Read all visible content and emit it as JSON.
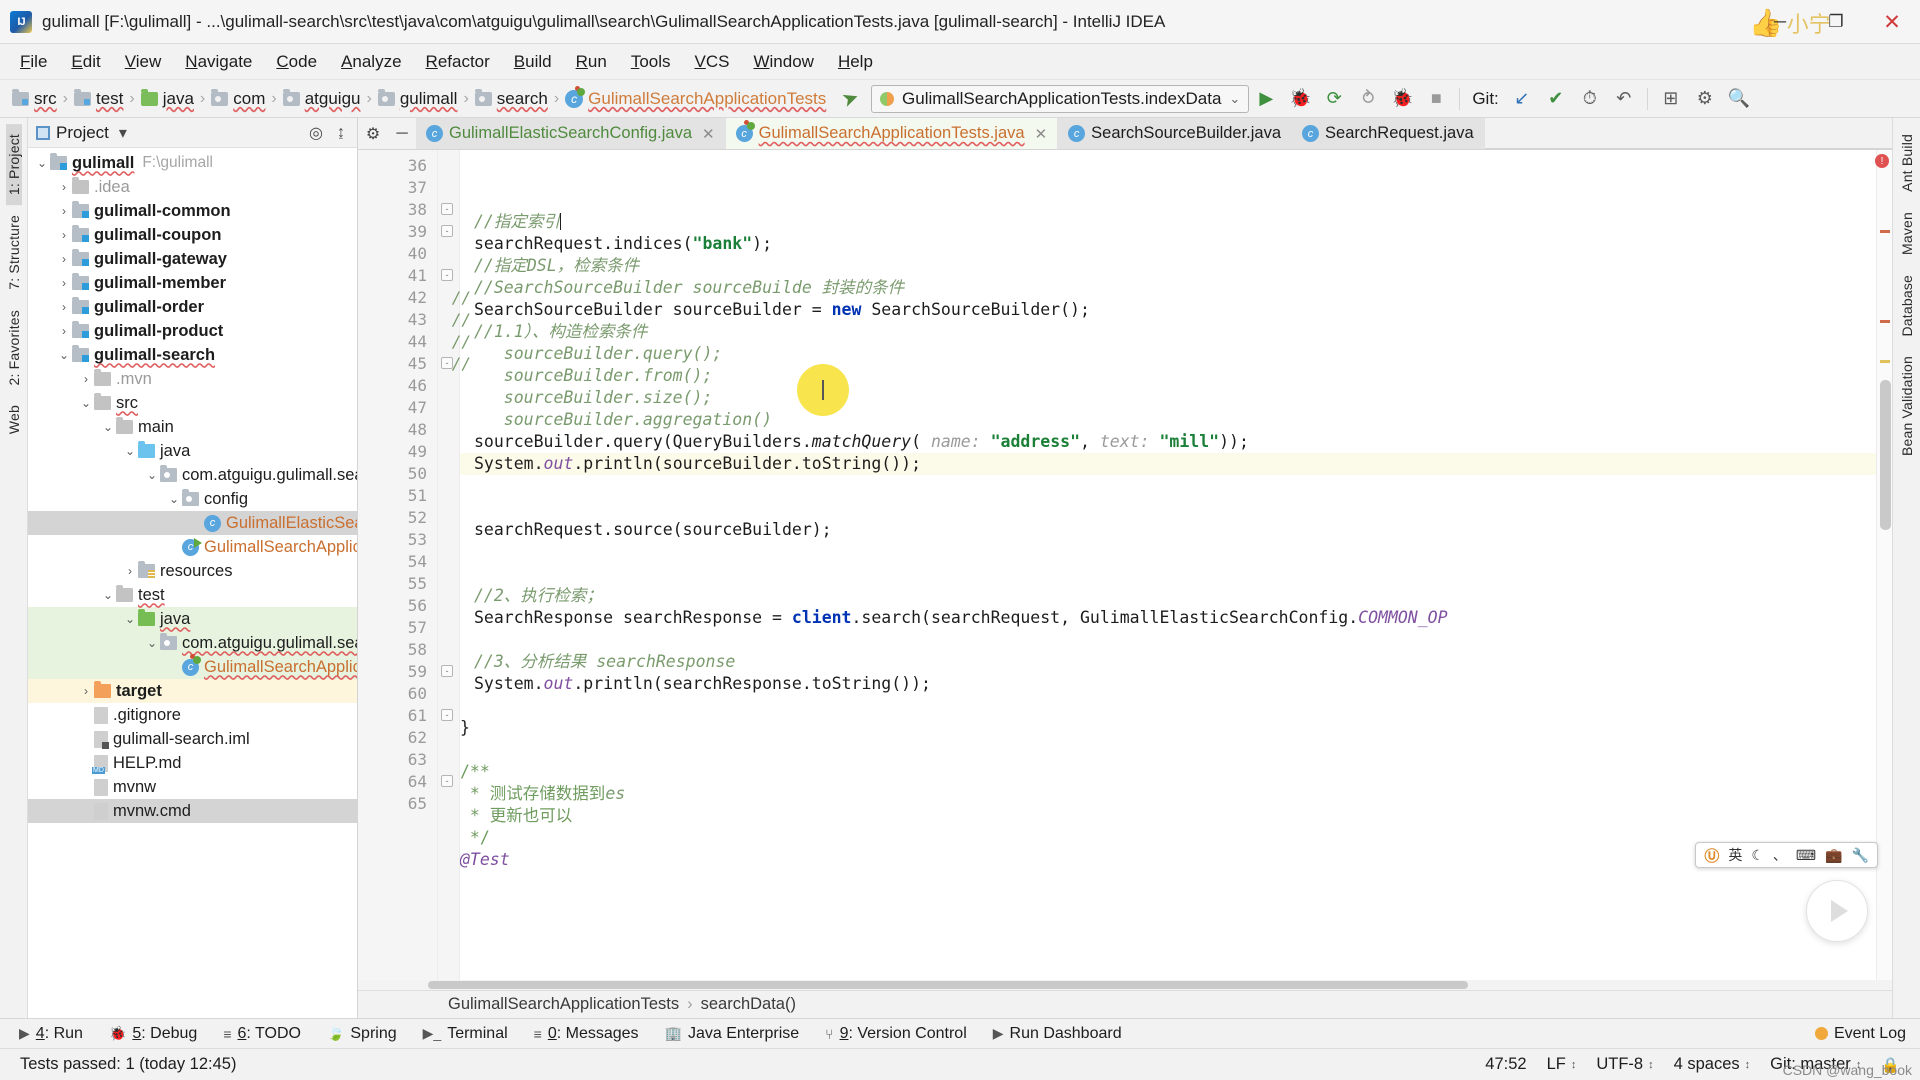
{
  "window": {
    "title": "gulimall [F:\\gulimall] - ...\\gulimall-search\\src\\test\\java\\com\\atguigu\\gulimall\\search\\GulimallSearchApplicationTests.java [gulimall-search] - IntelliJ IDEA",
    "logo_text": "IJ",
    "minimize": "─",
    "maximize": "❐",
    "close": "✕",
    "watermark_hand": "👍",
    "watermark_text": "小宁"
  },
  "menubar": {
    "items": [
      {
        "label": "File"
      },
      {
        "label": "Edit"
      },
      {
        "label": "View"
      },
      {
        "label": "Navigate"
      },
      {
        "label": "Code"
      },
      {
        "label": "Analyze"
      },
      {
        "label": "Refactor"
      },
      {
        "label": "Build"
      },
      {
        "label": "Run"
      },
      {
        "label": "Tools"
      },
      {
        "label": "VCS"
      },
      {
        "label": "Window"
      },
      {
        "label": "Help"
      }
    ]
  },
  "breadcrumb": {
    "items": [
      {
        "label": "src",
        "icon": "folder-source-icon",
        "kind": "src"
      },
      {
        "label": "test",
        "icon": "folder-test-icon",
        "kind": "src"
      },
      {
        "label": "java",
        "icon": "folder-java-icon",
        "kind": "green"
      },
      {
        "label": "com",
        "icon": "package-icon",
        "kind": "pkg"
      },
      {
        "label": "atguigu",
        "icon": "package-icon",
        "kind": "pkg"
      },
      {
        "label": "gulimall",
        "icon": "package-icon",
        "kind": "pkg"
      },
      {
        "label": "search",
        "icon": "package-icon",
        "kind": "pkg"
      },
      {
        "label": "GulimallSearchApplicationTests",
        "icon": "class-test-icon",
        "kind": "class"
      }
    ],
    "separator": "›"
  },
  "toolbar": {
    "build_icon": "hammer-icon",
    "run_config": "GulimallSearchApplicationTests.indexData",
    "run_config_chevron": "⌄",
    "run_button": "▶",
    "debug_button": "🐞",
    "run_coverage_button": "⟳",
    "profile_button": "⥁",
    "attach_button": "🐞",
    "stop_button": "■",
    "git_label": "Git:",
    "git_update": "↙",
    "git_commit": "✔",
    "git_history": "⏱",
    "git_revert": "↶",
    "search_everywhere": "⊞",
    "settings_icon": "⚙",
    "find_icon": "🔍"
  },
  "project_panel": {
    "title": "Project",
    "title_chevron": "▾",
    "locate_icon": "crosshair-icon",
    "collapse_icon": "collapse-all-icon",
    "tree": [
      {
        "depth": 0,
        "twisty": "⌄",
        "icon": "folder-module-icon",
        "icon_kind": "mod",
        "label": "gulimall",
        "bold": true,
        "suffix": "F:\\gulimall",
        "spell": true,
        "hl": ""
      },
      {
        "depth": 1,
        "twisty": "›",
        "icon": "folder-icon",
        "icon_kind": "gray",
        "label": ".idea",
        "bold": false,
        "dim": true,
        "hl": ""
      },
      {
        "depth": 1,
        "twisty": "›",
        "icon": "folder-module-icon",
        "icon_kind": "mod",
        "label": "gulimall-common",
        "bold": true,
        "hl": ""
      },
      {
        "depth": 1,
        "twisty": "›",
        "icon": "folder-module-icon",
        "icon_kind": "mod",
        "label": "gulimall-coupon",
        "bold": true,
        "hl": ""
      },
      {
        "depth": 1,
        "twisty": "›",
        "icon": "folder-module-icon",
        "icon_kind": "mod",
        "label": "gulimall-gateway",
        "bold": true,
        "hl": ""
      },
      {
        "depth": 1,
        "twisty": "›",
        "icon": "folder-module-icon",
        "icon_kind": "mod",
        "label": "gulimall-member",
        "bold": true,
        "hl": ""
      },
      {
        "depth": 1,
        "twisty": "›",
        "icon": "folder-module-icon",
        "icon_kind": "mod",
        "label": "gulimall-order",
        "bold": true,
        "hl": ""
      },
      {
        "depth": 1,
        "twisty": "›",
        "icon": "folder-module-icon",
        "icon_kind": "mod",
        "label": "gulimall-product",
        "bold": true,
        "hl": ""
      },
      {
        "depth": 1,
        "twisty": "⌄",
        "icon": "folder-module-icon",
        "icon_kind": "mod",
        "label": "gulimall-search",
        "bold": true,
        "spell": true,
        "hl": ""
      },
      {
        "depth": 2,
        "twisty": "›",
        "icon": "folder-icon",
        "icon_kind": "gray",
        "label": ".mvn",
        "dim": true,
        "hl": ""
      },
      {
        "depth": 2,
        "twisty": "⌄",
        "icon": "folder-icon",
        "icon_kind": "gray",
        "label": "src",
        "spell": true,
        "hl": ""
      },
      {
        "depth": 3,
        "twisty": "⌄",
        "icon": "folder-icon",
        "icon_kind": "gray",
        "label": "main",
        "hl": ""
      },
      {
        "depth": 4,
        "twisty": "⌄",
        "icon": "folder-java-icon",
        "icon_kind": "blue",
        "label": "java",
        "hl": ""
      },
      {
        "depth": 5,
        "twisty": "⌄",
        "icon": "package-icon",
        "icon_kind": "pkg",
        "label": "com.atguigu.gulimall.sear",
        "hl": ""
      },
      {
        "depth": 6,
        "twisty": "⌄",
        "icon": "package-icon",
        "icon_kind": "pkg",
        "label": "config",
        "hl": ""
      },
      {
        "depth": 7,
        "twisty": "",
        "icon": "class-icon",
        "icon_kind": "c",
        "label": "GulimallElasticSear",
        "cls": true,
        "hl": "gray"
      },
      {
        "depth": 6,
        "twisty": "",
        "icon": "class-runnable-icon",
        "icon_kind": "run",
        "label": "GulimallSearchApplica",
        "cls": true,
        "hl": ""
      },
      {
        "depth": 4,
        "twisty": "›",
        "icon": "folder-resources-icon",
        "icon_kind": "res",
        "label": "resources",
        "hl": ""
      },
      {
        "depth": 3,
        "twisty": "⌄",
        "icon": "folder-icon",
        "icon_kind": "gray",
        "label": "test",
        "spell": true,
        "hl": ""
      },
      {
        "depth": 4,
        "twisty": "⌄",
        "icon": "folder-java-test-icon",
        "icon_kind": "green",
        "label": "java",
        "spell": true,
        "hl": "green"
      },
      {
        "depth": 5,
        "twisty": "⌄",
        "icon": "package-icon",
        "icon_kind": "pkg",
        "label": "com.atguigu.gulimall.sear",
        "spell": true,
        "hl": "green"
      },
      {
        "depth": 6,
        "twisty": "",
        "icon": "class-test-icon",
        "icon_kind": "test",
        "label": "GulimallSearchApplica",
        "cls": true,
        "spell": true,
        "hl": "green"
      },
      {
        "depth": 2,
        "twisty": "›",
        "icon": "folder-target-icon",
        "icon_kind": "orange",
        "label": "target",
        "bold": true,
        "hl": "yellow"
      },
      {
        "depth": 2,
        "twisty": "",
        "icon": "file-icon",
        "icon_kind": "file",
        "label": ".gitignore",
        "hl": ""
      },
      {
        "depth": 2,
        "twisty": "",
        "icon": "file-iml-icon",
        "icon_kind": "iml",
        "label": "gulimall-search.iml",
        "hl": ""
      },
      {
        "depth": 2,
        "twisty": "",
        "icon": "file-md-icon",
        "icon_kind": "md",
        "label": "HELP.md",
        "hl": ""
      },
      {
        "depth": 2,
        "twisty": "",
        "icon": "file-icon",
        "icon_kind": "file",
        "label": "mvnw",
        "hl": ""
      },
      {
        "depth": 2,
        "twisty": "",
        "icon": "file-icon",
        "icon_kind": "file",
        "label": "mvnw.cmd",
        "hl": "gray"
      }
    ]
  },
  "left_rail": {
    "items": [
      {
        "label": "1: Project",
        "selected": true
      },
      {
        "label": "7: Structure",
        "selected": false
      },
      {
        "label": "2: Favorites",
        "selected": false
      },
      {
        "label": "Web",
        "selected": false
      }
    ]
  },
  "right_rail": {
    "items": [
      {
        "label": "Ant Build"
      },
      {
        "label": "Maven"
      },
      {
        "label": "Database"
      },
      {
        "label": "Bean Validation"
      }
    ]
  },
  "editor_tabs": {
    "gear_icon": "⚙",
    "minimize_icon": "─",
    "tabs": [
      {
        "label": "GulimallElasticSearchConfig.java",
        "icon": "class-icon",
        "active": false,
        "color": "green",
        "close": "✕"
      },
      {
        "label": "GulimallSearchApplicationTests.java",
        "icon": "class-test-icon",
        "active": true,
        "color": "orange",
        "close": "✕"
      },
      {
        "label": "SearchSourceBuilder.java",
        "icon": "class-icon",
        "active": false,
        "color": "dark",
        "close": ""
      },
      {
        "label": "SearchRequest.java",
        "icon": "class-icon",
        "active": false,
        "color": "dark",
        "close": ""
      }
    ]
  },
  "code": {
    "first_line": 36,
    "current_line": 47,
    "lines": [
      {
        "n": 36,
        "fold": "",
        "html": "<span class=\"cm\">//指定索引</span><span class=\"caret\"></span>"
      },
      {
        "n": 37,
        "fold": "",
        "html": "<span class=\"pln\">searchRequest.indices(</span><span class=\"str\">\"bank\"</span><span class=\"pln\">);</span>"
      },
      {
        "n": 38,
        "fold": "-",
        "html": "<span class=\"cm\">//指定DSL，检索条件</span>"
      },
      {
        "n": 39,
        "fold": "-",
        "html": "<span class=\"cm\">//SearchSourceBuilder sourceBuilde 封装的条件</span>"
      },
      {
        "n": 40,
        "fold": "",
        "html": "<span class=\"pln\">SearchSourceBuilder sourceBuilder = </span><span class=\"kw\">new</span><span class=\"pln\"> SearchSourceBuilder();</span>"
      },
      {
        "n": 41,
        "fold": "-",
        "html": "<span class=\"cm\">//1.1）、构造检索条件</span>"
      },
      {
        "n": 42,
        "fold": "",
        "gutmark": "//",
        "html": "<span class=\"cm\">   sourceBuilder.query();</span>"
      },
      {
        "n": 43,
        "fold": "",
        "gutmark": "//",
        "html": "<span class=\"cm\">   sourceBuilder.from();</span>"
      },
      {
        "n": 44,
        "fold": "",
        "gutmark": "//",
        "html": "<span class=\"cm\">   sourceBuilder.size();</span>"
      },
      {
        "n": 45,
        "fold": "-",
        "gutmark": "//",
        "html": "<span class=\"cm\">   sourceBuilder.aggregation()</span>"
      },
      {
        "n": 46,
        "fold": "",
        "html": "<span class=\"pln\">sourceBuilder.query(QueryBuilders.</span><span class=\"mth\">matchQuery</span><span class=\"pln\">( </span><span class=\"hint\">name:</span><span class=\"pln\"> </span><span class=\"str\">\"address\"</span><span class=\"pln\">, </span><span class=\"hint\">text:</span><span class=\"pln\"> </span><span class=\"str\">\"mill\"</span><span class=\"pln\">));</span>"
      },
      {
        "n": 47,
        "fold": "",
        "current": true,
        "html": "<span class=\"pln\">System.</span><span class=\"fld\">out</span><span class=\"pln\">.println(sourceBuilder.toString());</span>"
      },
      {
        "n": 48,
        "fold": "",
        "html": ""
      },
      {
        "n": 49,
        "fold": "",
        "html": ""
      },
      {
        "n": 50,
        "fold": "",
        "html": "<span class=\"pln\">searchRequest.source(sourceBuilder);</span>"
      },
      {
        "n": 51,
        "fold": "",
        "html": ""
      },
      {
        "n": 52,
        "fold": "",
        "html": ""
      },
      {
        "n": 53,
        "fold": "",
        "html": "<span class=\"cm\">//2、执行检索；</span>"
      },
      {
        "n": 54,
        "fold": "",
        "html": "<span class=\"pln\">SearchResponse searchResponse = </span><span class=\"kw\">client</span><span class=\"pln\">.search(searchRequest, GulimallElasticSearchConfig.</span><span class=\"cst\">COMMON_OP</span>"
      },
      {
        "n": 55,
        "fold": "",
        "html": ""
      },
      {
        "n": 56,
        "fold": "",
        "html": "<span class=\"cm\">//3、分析结果 </span><span class=\"cm\">searchResponse</span>"
      },
      {
        "n": 57,
        "fold": "",
        "html": "<span class=\"pln\">System.</span><span class=\"fld\">out</span><span class=\"pln\">.println(searchResponse.toString());</span>"
      },
      {
        "n": 58,
        "fold": "",
        "html": ""
      },
      {
        "n": 59,
        "fold": "-",
        "html": "<span class=\"pln\">}</span>",
        "indent": -1
      },
      {
        "n": 60,
        "fold": "",
        "html": ""
      },
      {
        "n": 61,
        "fold": "-",
        "html": "<span class=\"cmn\">/**</span>",
        "indent": -1
      },
      {
        "n": 62,
        "fold": "",
        "html": "<span class=\"cmn\"> * 测试存储数据到</span><span class=\"cm\">es</span>",
        "indent": -1
      },
      {
        "n": 63,
        "fold": "",
        "html": "<span class=\"cmn\"> * 更新也可以</span>",
        "indent": -1
      },
      {
        "n": 64,
        "fold": "-",
        "html": "<span class=\"cmn\"> */</span>",
        "indent": -1
      },
      {
        "n": 65,
        "fold": "",
        "html": "<span class=\"cst\">@Test</span>",
        "indent": -1
      }
    ]
  },
  "editor_breadcrumb": {
    "items": [
      "GulimallSearchApplicationTests",
      "searchData()"
    ],
    "separator": "›"
  },
  "ime": {
    "logo": "Ⓤ",
    "lang": "英",
    "moon": "☾",
    "punct": "、",
    "keyboard": "⌨",
    "tool": "💼",
    "wrench": "🔧"
  },
  "bottom_bar": {
    "items": [
      {
        "icon": "▶",
        "label": "4: Run"
      },
      {
        "icon": "🐞",
        "label": "5: Debug"
      },
      {
        "icon": "≡",
        "label": "6: TODO"
      },
      {
        "icon": "🍃",
        "label": "Spring"
      },
      {
        "icon": "▶_",
        "label": "Terminal"
      },
      {
        "icon": "≡",
        "label": "0: Messages"
      },
      {
        "icon": "🏢",
        "label": "Java Enterprise"
      },
      {
        "icon": "⑂",
        "label": "9: Version Control"
      },
      {
        "icon": "▶",
        "label": "Run Dashboard"
      }
    ],
    "event_log": "Event Log",
    "event_log_icon": "event-log-icon"
  },
  "status_bar": {
    "message": "Tests passed: 1 (today 12:45)",
    "caret_position": "47:52",
    "line_separator": "LF",
    "encoding": "UTF-8",
    "indent": "4 spaces",
    "git_branch": "Git: master",
    "lock_icon": "🔒",
    "chevron": "↕"
  },
  "watermark_footer": "CSDN @wang_book"
}
